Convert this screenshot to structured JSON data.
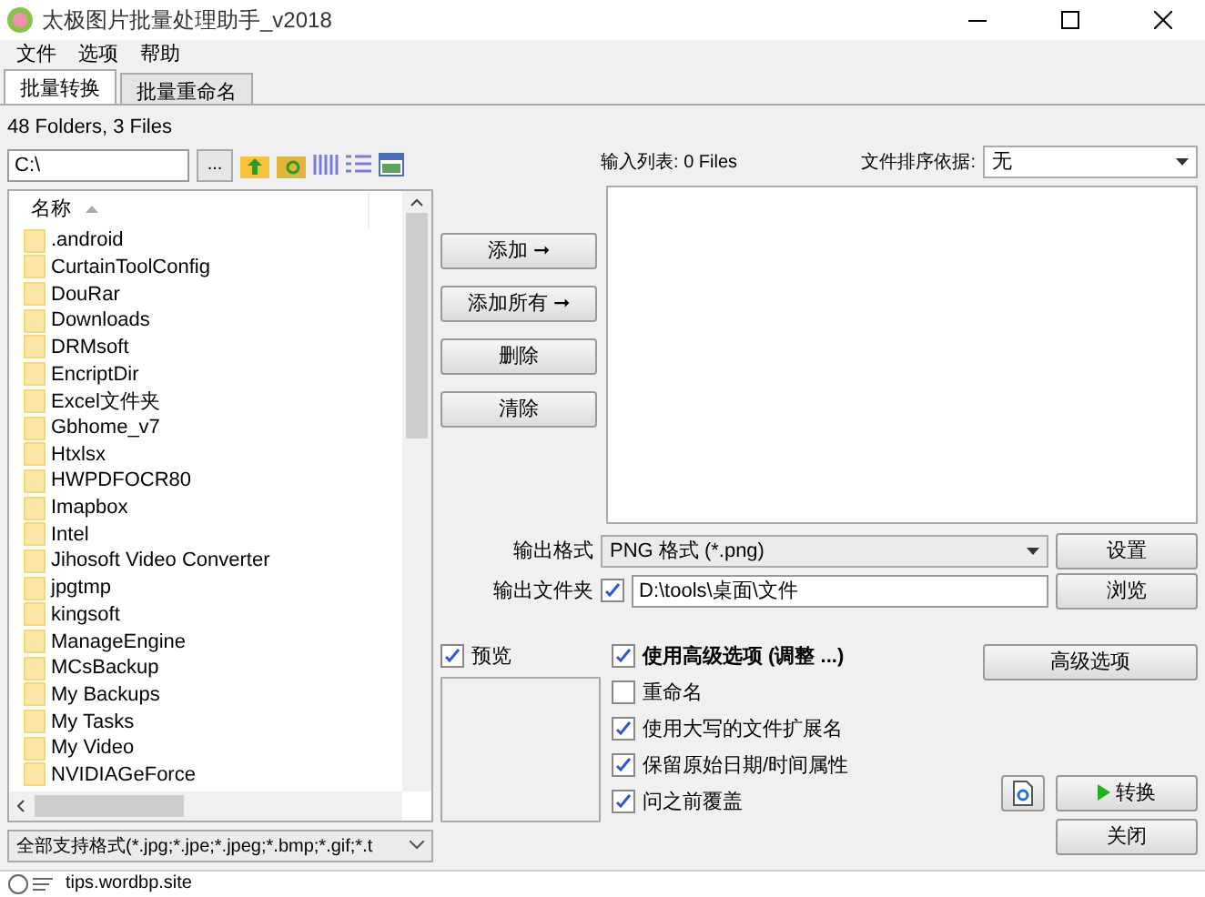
{
  "window": {
    "title": "太极图片批量处理助手_v2018"
  },
  "menu": [
    "文件",
    "选项",
    "帮助"
  ],
  "tabs": [
    {
      "label": "批量转换",
      "selected": true
    },
    {
      "label": "批量重命名",
      "selected": false
    }
  ],
  "browser": {
    "summary": "48 Folders, 3 Files",
    "path": "C:\\",
    "browse_label": "...",
    "header": "名称",
    "files": [
      ".android",
      "CurtainToolConfig",
      "DouRar",
      "Downloads",
      "DRMsoft",
      "EncriptDir",
      "Excel文件夹",
      "Gbhome_v7",
      "Htxlsx",
      "HWPDFOCR80",
      "Imapbox",
      "Intel",
      "Jihosoft Video Converter",
      "jpgtmp",
      "kingsoft",
      "ManageEngine",
      "MCsBackup",
      "My Backups",
      "My Tasks",
      "My Video",
      "NVIDIAGeForce"
    ],
    "filter": "全部支持格式(*.jpg;*.jpe;*.jpeg;*.bmp;*.gif;*.t"
  },
  "input_list": {
    "label": "输入列表:",
    "count": "0 Files"
  },
  "sort": {
    "label": "文件排序依据:",
    "value": "无"
  },
  "actions": [
    "添加 ➞",
    "添加所有 ➞",
    "删除",
    "清除"
  ],
  "output_format": {
    "label": "输出格式",
    "value": "PNG 格式 (*.png)",
    "button": "设置"
  },
  "output_folder": {
    "label": "输出文件夹",
    "checked": true,
    "value": "D:\\tools\\桌面\\文件",
    "button": "浏览"
  },
  "preview": {
    "label": "预览",
    "checked": true
  },
  "options": [
    {
      "label": "使用高级选项 (调整 ...)",
      "checked": true,
      "emphasis": true
    },
    {
      "label": "重命名",
      "checked": false,
      "emphasis": false
    },
    {
      "label": "使用大写的文件扩展名",
      "checked": true,
      "emphasis": false
    },
    {
      "label": "保留原始日期/时间属性",
      "checked": true,
      "emphasis": false
    },
    {
      "label": "问之前覆盖",
      "checked": true,
      "emphasis": false
    }
  ],
  "advanced_button": "高级选项",
  "convert_button": "转换",
  "close_button": "关闭",
  "status": "tips.wordbp.site"
}
